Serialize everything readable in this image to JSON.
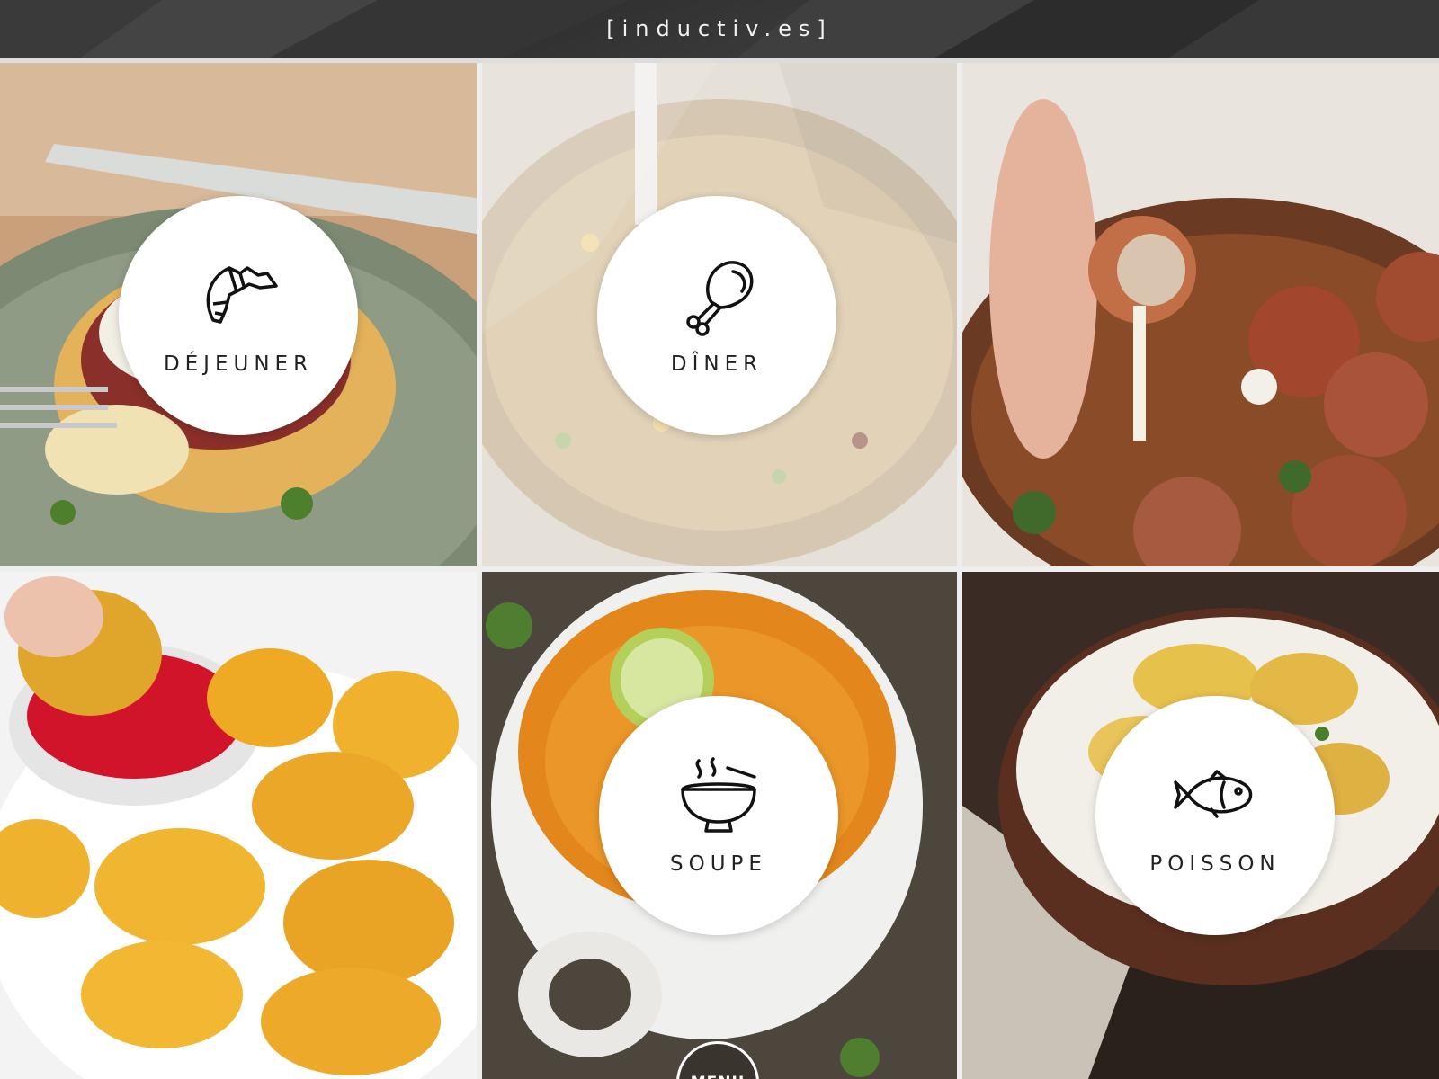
{
  "header": {
    "logo": "[inductiv.es]"
  },
  "tiles": [
    {
      "label": "DÉJEUNER",
      "icon": "croissant-icon"
    },
    {
      "label": "DÎNER",
      "icon": "chicken-leg-icon"
    },
    {
      "label": "",
      "icon": ""
    },
    {
      "label": "",
      "icon": ""
    },
    {
      "label": "SOUPE",
      "icon": "soup-bowl-icon"
    },
    {
      "label": "POISSON",
      "icon": "fish-icon"
    }
  ],
  "menu": {
    "label": "MENU"
  },
  "colors": {
    "header_bg": "#2f2f2f",
    "circle_bg": "#ffffff",
    "label_text": "#222222"
  }
}
